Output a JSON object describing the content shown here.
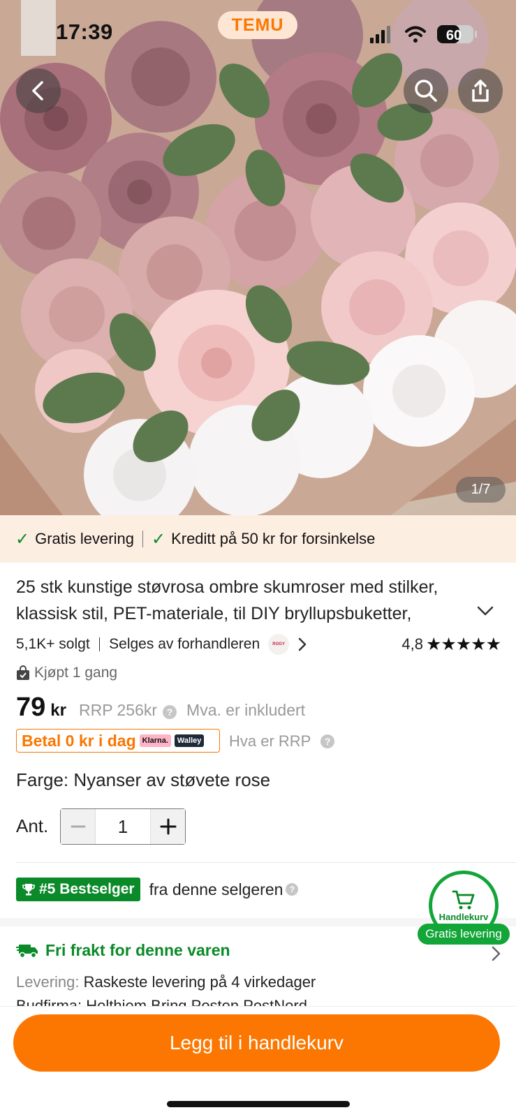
{
  "status_bar": {
    "time": "17:39",
    "app_badge": "TEMU",
    "battery": "60"
  },
  "gallery": {
    "counter": "1/7"
  },
  "promo": {
    "item1": "Gratis levering",
    "item2": "Kreditt på 50 kr for forsinkelse"
  },
  "product": {
    "title": "25 stk kunstige støvrosa ombre skumroser med stilker, klassisk stil, PET-materiale, til DIY bryllupsbuketter,",
    "sold": "5,1K+ solgt",
    "seller": "Selges av forhandleren",
    "seller_logo": "ROGY",
    "rating": "4,8",
    "bought": "Kjøpt 1 gang",
    "price": "79",
    "currency": "kr",
    "rrp": "RRP 256kr",
    "vat": "Mva. er inkludert",
    "pay_today": "Betal 0 kr i dag",
    "klarna": "Klarna.",
    "walley": "Walley",
    "rrp_info": "Hva er RRP",
    "color": "Farge: Nyanser av støvete rose",
    "qty_label": "Ant.",
    "qty_value": "1"
  },
  "bestseller": {
    "badge": "#5 Bestselger",
    "text": "fra denne selgeren"
  },
  "shipping": {
    "title": "Fri frakt for denne varen",
    "delivery_label": "Levering:",
    "delivery_value": "Raskeste levering på 4 virkedager",
    "carriers_cut": "Budfirma: Helthjem  Bring  Posten  PostNord"
  },
  "cart": {
    "label": "Handlekurv",
    "badge": "Gratis levering"
  },
  "cta": {
    "add_to_cart": "Legg til i handlekurv"
  },
  "colors": {
    "accent": "#fb7701",
    "green": "#0a8a28"
  }
}
